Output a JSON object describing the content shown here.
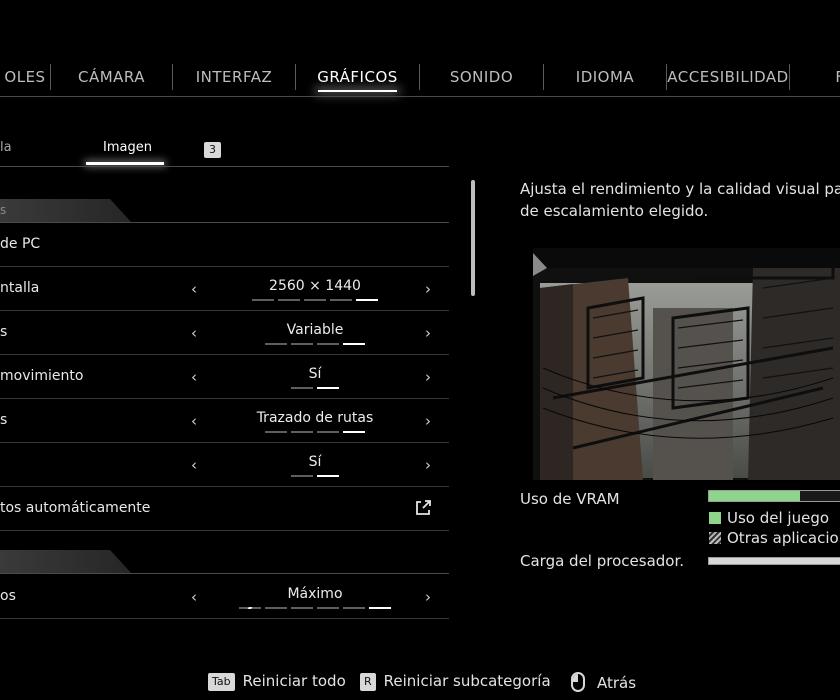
{
  "tabs": [
    {
      "label": "OLES",
      "active": false
    },
    {
      "label": "CÁMARA",
      "active": false
    },
    {
      "label": "INTERFAZ",
      "active": false
    },
    {
      "label": "GRÁFICOS",
      "active": true
    },
    {
      "label": "SONIDO",
      "active": false
    },
    {
      "label": "IDIOMA",
      "active": false
    },
    {
      "label": "ACCESIBILIDAD",
      "active": false
    },
    {
      "label": "F",
      "active": false
    }
  ],
  "subtabs": {
    "first": "la",
    "active": "Imagen",
    "key_hint": "3"
  },
  "sections": [
    {
      "label": "s"
    },
    {
      "label": ""
    }
  ],
  "settings": [
    {
      "label": "de PC",
      "value": "",
      "pips": 0,
      "selected": 0,
      "type": "header-link"
    },
    {
      "label": "ntalla",
      "value": "2560 × 1440",
      "pips": 5,
      "selected": 5,
      "type": "choice"
    },
    {
      "label": "s",
      "value": "Variable",
      "pips": 4,
      "selected": 4,
      "type": "choice"
    },
    {
      "label": "movimiento",
      "value": "Sí",
      "pips": 2,
      "selected": 2,
      "type": "choice"
    },
    {
      "label": "s",
      "value": "Trazado de rutas",
      "pips": 4,
      "selected": 4,
      "type": "choice"
    },
    {
      "label": "",
      "value": "Sí",
      "pips": 2,
      "selected": 2,
      "type": "choice"
    },
    {
      "label": "tos automáticamente",
      "value": "",
      "pips": 0,
      "selected": 0,
      "type": "external"
    },
    {
      "label": "os",
      "value": "Máximo",
      "pips": 6,
      "selected": 6,
      "type": "choice"
    }
  ],
  "description": {
    "line1": "Ajusta el rendimiento y la calidad visual par",
    "line2": "de escalamiento elegido."
  },
  "vram": {
    "label": "Uso de VRAM",
    "game_fraction": 0.66,
    "legend_game": "Uso del juego",
    "legend_other": "Otras aplicacion"
  },
  "cpu": {
    "label": "Carga del procesador.",
    "fraction": 0.95
  },
  "footer": {
    "reset_all_key": "Tab",
    "reset_all_label": "Reiniciar todo",
    "reset_sub_key": "R",
    "reset_sub_label": "Reiniciar subcategoría",
    "back_label": "Atrás"
  },
  "colors": {
    "accent_green": "#8fd48b",
    "background": "#000000"
  }
}
